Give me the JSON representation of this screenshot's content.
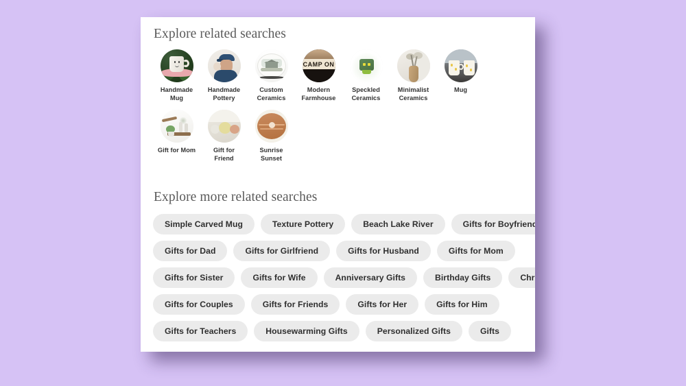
{
  "page": {
    "background_color": "#d6c2f5",
    "card_background": "#ffffff"
  },
  "related_searches": {
    "heading": "Explore related searches",
    "items": [
      {
        "label": "Handmade Mug",
        "art": "mug-face",
        "caption_line1": "Handmade",
        "caption_line2": "Mug"
      },
      {
        "label": "Handmade Pottery",
        "art": "potter",
        "caption_line1": "Handmade",
        "caption_line2": "Pottery"
      },
      {
        "label": "Custom Ceramics",
        "art": "plate",
        "caption_line1": "Custom",
        "caption_line2": "Ceramics"
      },
      {
        "label": "Modern Farmhouse",
        "art": "camp",
        "caption_line1": "Modern",
        "caption_line2": "Farmhouse",
        "art_text": "CAMP ON"
      },
      {
        "label": "Speckled Ceramics",
        "art": "green",
        "caption_line1": "Speckled",
        "caption_line2": "Ceramics"
      },
      {
        "label": "Minimalist Ceramics",
        "art": "vase",
        "caption_line1": "Minimalist",
        "caption_line2": "Ceramics"
      },
      {
        "label": "Mug",
        "art": "twomug",
        "caption_line1": "Mug",
        "caption_line2": ""
      },
      {
        "label": "Gift for Mom",
        "art": "shelf",
        "caption_line1": "Gift for Mom",
        "caption_line2": ""
      },
      {
        "label": "Gift for Friend",
        "art": "soap",
        "caption_line1": "Gift for",
        "caption_line2": "Friend"
      },
      {
        "label": "Sunrise Sunset",
        "art": "sun",
        "caption_line1": "Sunrise",
        "caption_line2": "Sunset"
      }
    ]
  },
  "more_related_searches": {
    "heading": "Explore more related searches",
    "rows": [
      [
        "Simple Carved Mug",
        "Texture Pottery",
        "Beach Lake River",
        "Gifts for Boyfriend"
      ],
      [
        "Gifts for Dad",
        "Gifts for Girlfriend",
        "Gifts for Husband",
        "Gifts for Mom"
      ],
      [
        "Gifts for Sister",
        "Gifts for Wife",
        "Anniversary Gifts",
        "Birthday Gifts",
        "Christmas Gifts"
      ],
      [
        "Gifts for Couples",
        "Gifts for Friends",
        "Gifts for Her",
        "Gifts for Him"
      ],
      [
        "Gifts for Teachers",
        "Housewarming Gifts",
        "Personalized Gifts",
        "Gifts"
      ]
    ]
  }
}
